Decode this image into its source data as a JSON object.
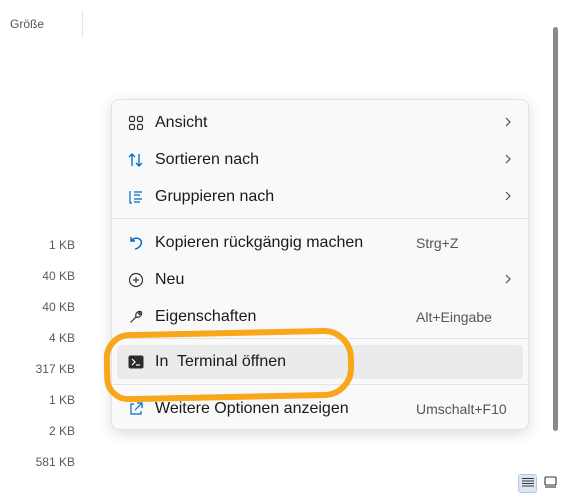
{
  "column_header": {
    "label": "Größe"
  },
  "file_sizes": [
    "1 KB",
    "40 KB",
    "40 KB",
    "4 KB",
    "317 KB",
    "1 KB",
    "2 KB",
    "581 KB"
  ],
  "context_menu": {
    "items": [
      {
        "label": "Ansicht",
        "icon": "grid-icon",
        "has_submenu": true
      },
      {
        "label": "Sortieren nach",
        "icon": "sort-icon",
        "has_submenu": true
      },
      {
        "label": "Gruppieren nach",
        "icon": "group-icon",
        "has_submenu": true
      },
      {
        "label": "Kopieren rückgängig machen",
        "icon": "undo-icon",
        "shortcut": "Strg+Z"
      },
      {
        "label": "Neu",
        "icon": "new-icon",
        "has_submenu": true
      },
      {
        "label": "Eigenschaften",
        "icon": "wrench-icon",
        "shortcut": "Alt+Eingabe"
      },
      {
        "label": "In  Terminal öffnen",
        "icon": "terminal-icon",
        "highlighted": true
      },
      {
        "label": "Weitere Optionen anzeigen",
        "icon": "external-icon",
        "shortcut": "Umschalt+F10"
      }
    ]
  },
  "view_buttons": [
    {
      "name": "details-view",
      "active": true
    },
    {
      "name": "tiles-view",
      "active": false
    }
  ],
  "colors": {
    "accent": "#0067c0",
    "highlight_ring": "#f8a61a"
  }
}
